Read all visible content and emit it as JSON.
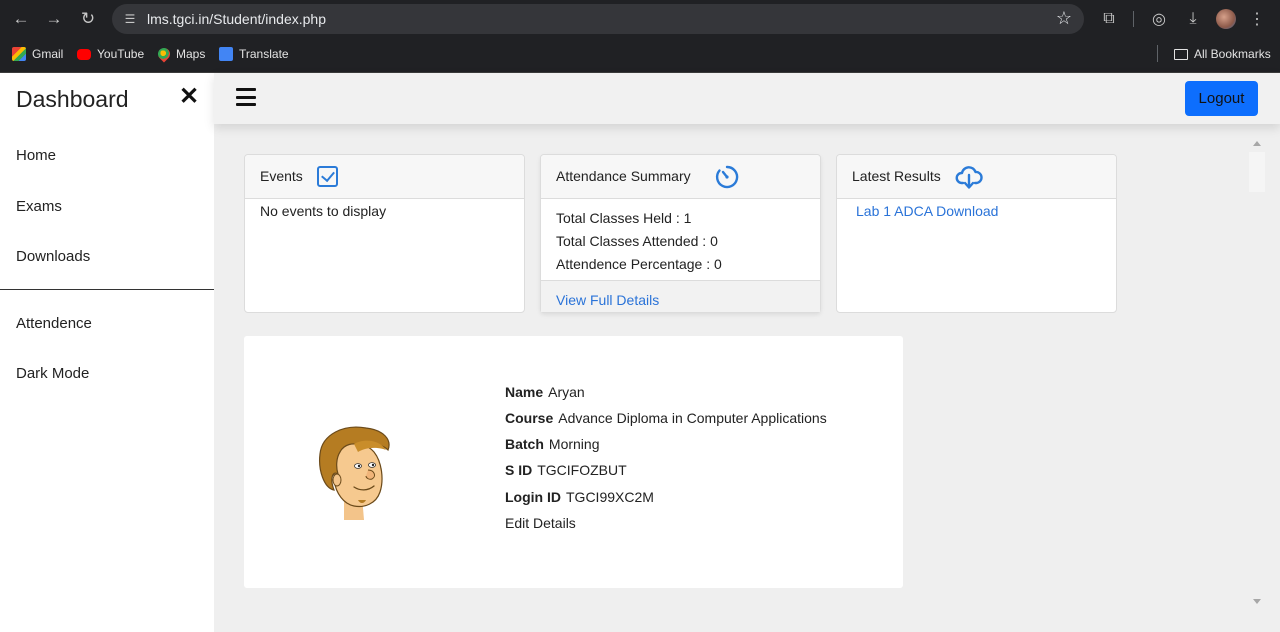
{
  "browser": {
    "url": "lms.tgci.in/Student/index.php",
    "bookmarks": [
      "Gmail",
      "YouTube",
      "Maps",
      "Translate"
    ],
    "all_bookmarks": "All Bookmarks"
  },
  "sidebar": {
    "title": "Dashboard",
    "close_symbol": "✕",
    "items": [
      {
        "label": "Home"
      },
      {
        "label": "Exams"
      },
      {
        "label": "Downloads"
      },
      {
        "label": "Attendence"
      },
      {
        "label": "Dark Mode"
      }
    ]
  },
  "topbar": {
    "logout_label": "Logout"
  },
  "events": {
    "title": "Events",
    "empty_text": "No events to display"
  },
  "attendance": {
    "title": "Attendance Summary",
    "lines": [
      "Total Classes Held : 1",
      "Total Classes Attended : 0",
      "Attendence Percentage : 0"
    ],
    "link": "View Full Details"
  },
  "results": {
    "title": "Latest Results",
    "link": "Lab 1 ADCA Download"
  },
  "profile": {
    "fields": [
      {
        "label": "Name",
        "value": "Aryan"
      },
      {
        "label": "Course",
        "value": "Advance Diploma in Computer Applications"
      },
      {
        "label": "Batch",
        "value": "Morning"
      },
      {
        "label": "S ID",
        "value": "TGCIFOZBUT"
      },
      {
        "label": "Login ID",
        "value": "TGCI99XC2M"
      }
    ],
    "edit_link": "Edit Details"
  },
  "colors": {
    "accent": "#0d6efd",
    "link": "#2a73d8",
    "icon_blue": "#2b7bd8"
  }
}
